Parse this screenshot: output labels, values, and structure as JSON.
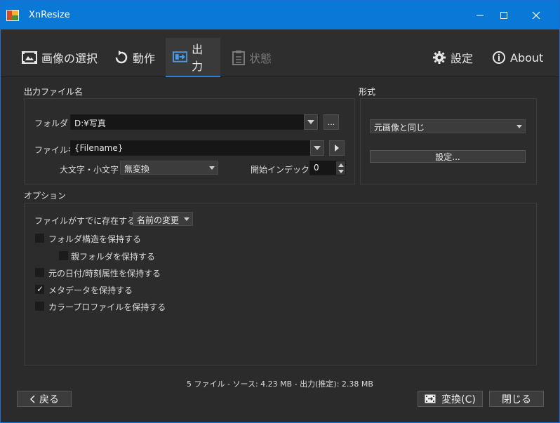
{
  "window": {
    "title": "XnResize"
  },
  "toolbar": {
    "select_images": "画像の選択",
    "actions": "動作",
    "output": "出力",
    "status": "状態",
    "settings": "設定",
    "about": "About"
  },
  "output_filename": {
    "section": "出力ファイル名",
    "folder_label": "フォルダ",
    "folder_value": "D:¥写真",
    "browse_label": "...",
    "filename_label": "ファイル名",
    "filename_value": "{Filename}",
    "case_label": "大文字・小文字",
    "case_value": "無変換",
    "start_index_label": "開始インデックス",
    "start_index_value": "0"
  },
  "format": {
    "section": "形式",
    "format_value": "元画像と同じ",
    "settings_button": "設定..."
  },
  "options": {
    "section": "オプション",
    "if_exists_label": "ファイルがすでに存在するとき",
    "if_exists_value": "名前の変更",
    "checkboxes": [
      {
        "label": "フォルダ構造を保持する",
        "checked": false
      },
      {
        "label": "親フォルダを保持する",
        "checked": false
      },
      {
        "label": "元の日付/時刻属性を保持する",
        "checked": false
      },
      {
        "label": "メタデータを保持する",
        "checked": true
      },
      {
        "label": "カラープロファイルを保持する",
        "checked": false
      }
    ]
  },
  "status_text": "5 ファイル - ソース: 4.23 MB - 出力(推定): 2.38 MB",
  "footer": {
    "back": "戻る",
    "convert": "変換(C)",
    "close": "閉じる"
  }
}
